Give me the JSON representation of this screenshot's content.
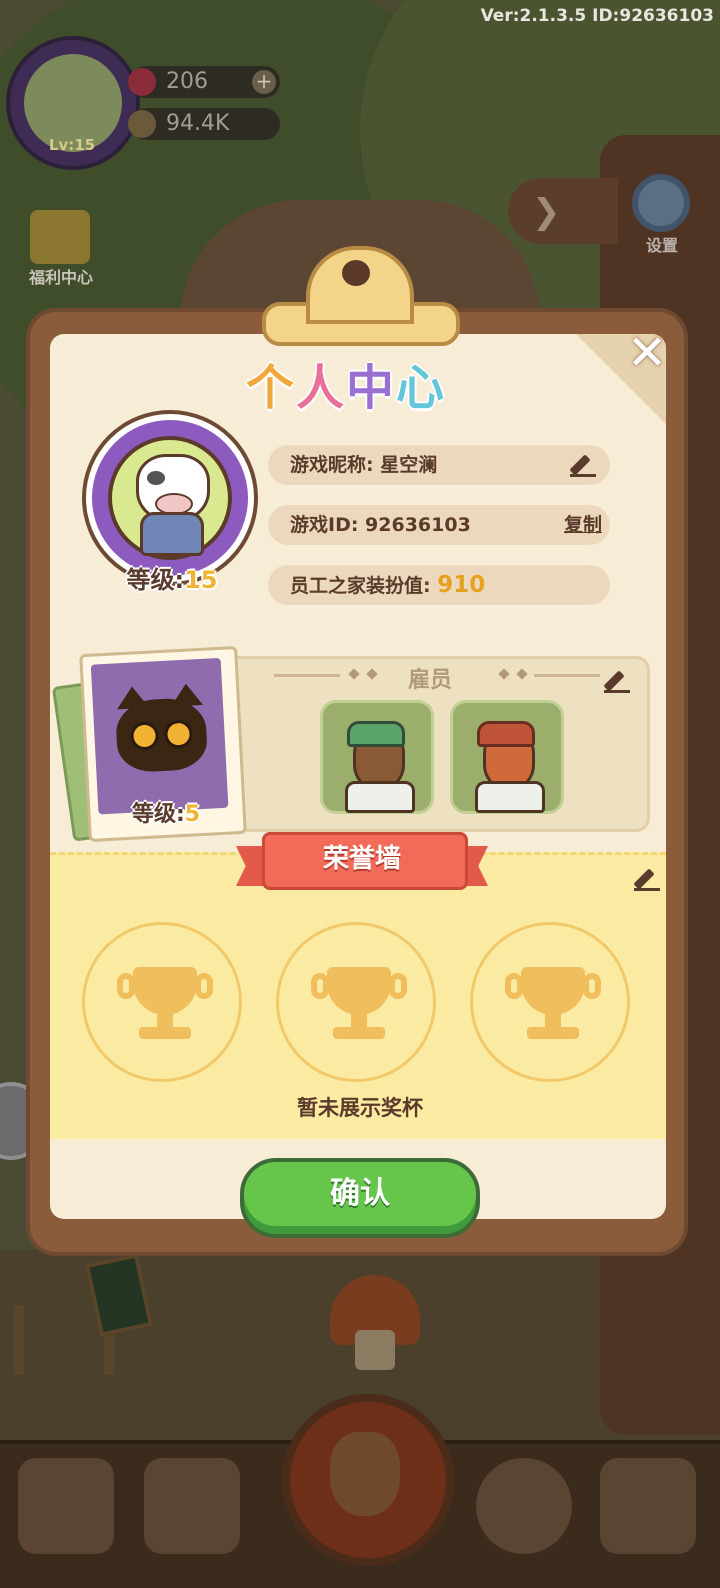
{
  "hud": {
    "version": "Ver:2.1.3.5 ID:92636103",
    "player_level": "Lv:15",
    "gems": "206",
    "acorns": "94.4K",
    "welfare_label": "福利中心",
    "settings_label": "设置"
  },
  "modal": {
    "title_chars": [
      "个",
      "人",
      "中",
      "心"
    ],
    "title_colors": [
      "#f0a83a",
      "#e96f9a",
      "#9a6fd1",
      "#63c6d9"
    ],
    "level_prefix": "等级:",
    "level_value": "15",
    "nickname_label": "游戏昵称: 星空澜",
    "id_label": "游戏ID: 92636103",
    "copy_label": "复制",
    "decor_label": "员工之家装扮值:",
    "decor_value": "910",
    "employees_title": "雇员",
    "pet_level_prefix": "等级:",
    "pet_level_value": "5",
    "honor_title": "荣誉墙",
    "no_trophy": "暂未展示奖杯",
    "confirm": "确认"
  },
  "colors": {
    "accent_green": "#66c64b",
    "ribbon_red": "#f26b58",
    "gold": "#f0b433"
  }
}
